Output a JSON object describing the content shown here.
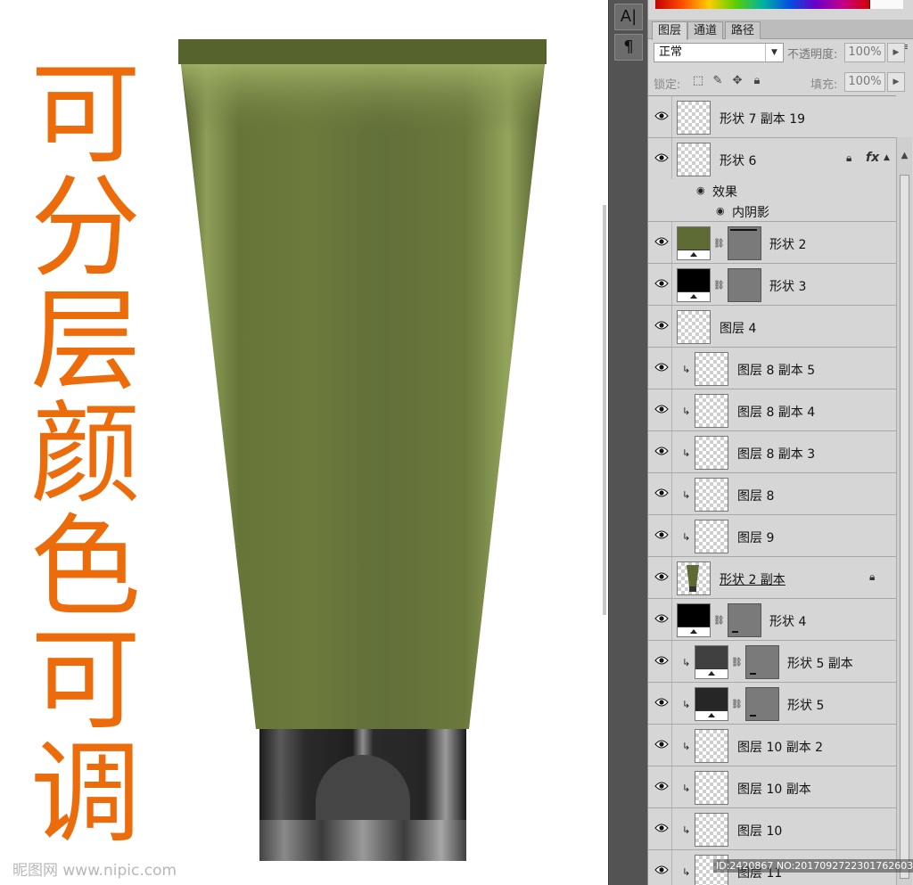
{
  "canvas": {
    "vertical_text": [
      "可",
      "分",
      "层",
      "颜",
      "色",
      "可",
      "调"
    ],
    "watermark": "昵图网 www.nipic.com"
  },
  "tools": {
    "char_tool": "A|",
    "para_tool": "¶"
  },
  "panel": {
    "tabs": [
      {
        "label": "图层",
        "active": true
      },
      {
        "label": "通道",
        "active": false
      },
      {
        "label": "路径",
        "active": false
      }
    ],
    "blend_mode": "正常",
    "opacity_label": "不透明度:",
    "opacity_value": "100%",
    "lock_label": "锁定:",
    "fill_label": "填充:",
    "fill_value": "100%",
    "effects_label": "效果",
    "inner_shadow_label": "内阴影",
    "fx_label": "fx"
  },
  "layers": [
    {
      "name": "形状 7 副本 19"
    },
    {
      "name": "形状 6"
    },
    {
      "name": "形状 2"
    },
    {
      "name": "形状 3"
    },
    {
      "name": "图层 4"
    },
    {
      "name": "图层 8 副本 5"
    },
    {
      "name": "图层 8 副本 4"
    },
    {
      "name": "图层 8 副本 3"
    },
    {
      "name": "图层 8"
    },
    {
      "name": "图层 9"
    },
    {
      "name": "形状 2 副本"
    },
    {
      "name": "形状 4"
    },
    {
      "name": "形状 5 副本"
    },
    {
      "name": "形状 5"
    },
    {
      "name": "图层 10 副本 2"
    },
    {
      "name": "图层 10 副本"
    },
    {
      "name": "图层 10"
    },
    {
      "name": "图层 11"
    }
  ],
  "status_text": "ID:2420867 NO:20170927223017626036",
  "colors": {
    "headline": "#ec6c0c",
    "tube_green": "#6b7a3e",
    "cap": "#3a3a3a"
  }
}
